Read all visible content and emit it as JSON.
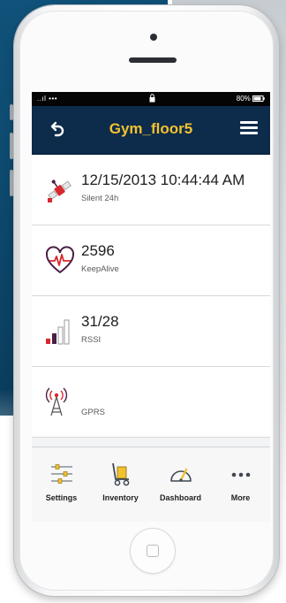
{
  "status_bar": {
    "carrier": "..ıl ••• ",
    "battery": "80%"
  },
  "header": {
    "title": "Gym_floor5"
  },
  "rows": [
    {
      "value": "12/15/2013 10:44:44 AM",
      "label": "Silent 24h",
      "icon": "satellite-icon"
    },
    {
      "value": "2596",
      "label": "KeepAlive",
      "icon": "heartbeat-icon"
    },
    {
      "value": "31/28",
      "label": "RSSI",
      "icon": "signal-bars-icon"
    },
    {
      "value": "",
      "label": "GPRS",
      "icon": "antenna-icon"
    }
  ],
  "tabs": [
    {
      "label": "Settings",
      "icon": "sliders-icon"
    },
    {
      "label": "Inventory",
      "icon": "hand-truck-icon"
    },
    {
      "label": "Dashboard",
      "icon": "gauge-icon"
    },
    {
      "label": "More",
      "icon": "ellipsis-icon"
    }
  ],
  "colors": {
    "nav_background": "#0d2b4a",
    "title_accent": "#f2c230",
    "icon_red": "#d8282e",
    "icon_purple": "#4a1f45"
  }
}
